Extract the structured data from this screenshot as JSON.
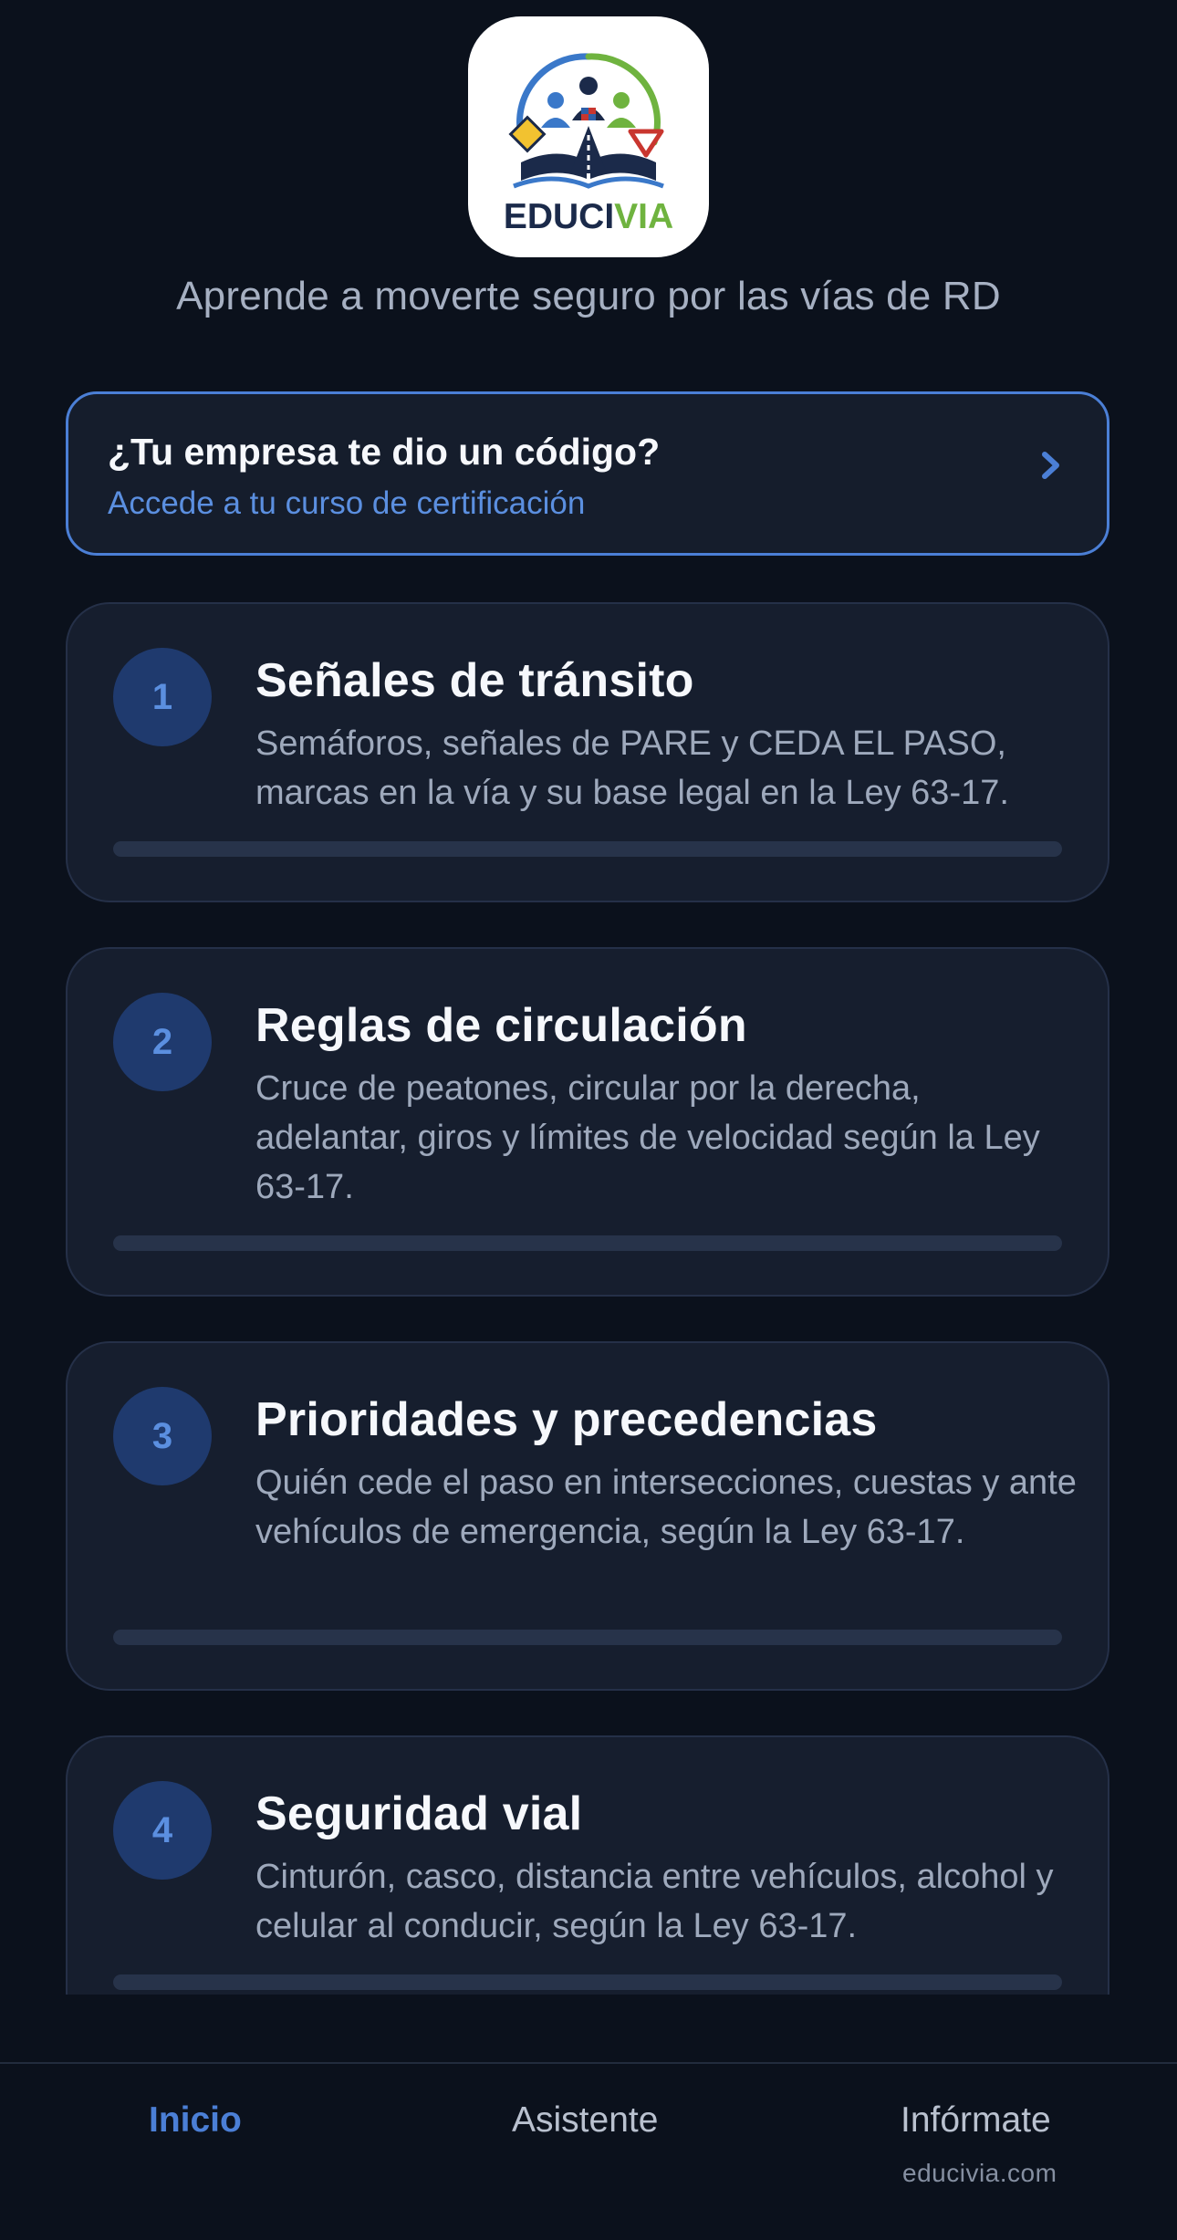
{
  "app": {
    "logo_text_left": "EDUCI",
    "logo_text_right": "VIA",
    "tagline": "Aprende a moverte seguro por las vías de RD",
    "brand_colors": {
      "accent_blue": "#4b7fd6",
      "logo_navy": "#1b2a4a",
      "logo_green": "#6fb33f"
    }
  },
  "code_banner": {
    "title": "¿Tu empresa te dio un código?",
    "subtitle": "Accede a tu curso de certificación",
    "icon": "chevron-right-icon"
  },
  "modules": [
    {
      "number": "1",
      "title": "Señales de tránsito",
      "description": "Semáforos, señales de PARE y CEDA EL PASO, marcas en la vía y su base legal en la Ley 63-17.",
      "progress": 0
    },
    {
      "number": "2",
      "title": "Reglas de circulación",
      "description": "Cruce de peatones, circular por la derecha, adelantar, giros y límites de velocidad según la Ley 63-17.",
      "progress": 0
    },
    {
      "number": "3",
      "title": "Prioridades y precedencias",
      "description": "Quién cede el paso en intersecciones, cuestas y ante vehículos de emergencia, según la Ley 63-17.",
      "progress": 0
    },
    {
      "number": "4",
      "title": "Seguridad vial",
      "description": "Cinturón, casco, distancia entre vehículos, alcohol y celular al conducir, según la Ley 63-17.",
      "progress": 0
    }
  ],
  "tabbar": {
    "tabs": [
      {
        "label": "Inicio",
        "active": true
      },
      {
        "label": "Asistente",
        "active": false
      },
      {
        "label": "Infórmate",
        "sublabel": "educivia.com",
        "active": false
      }
    ]
  }
}
